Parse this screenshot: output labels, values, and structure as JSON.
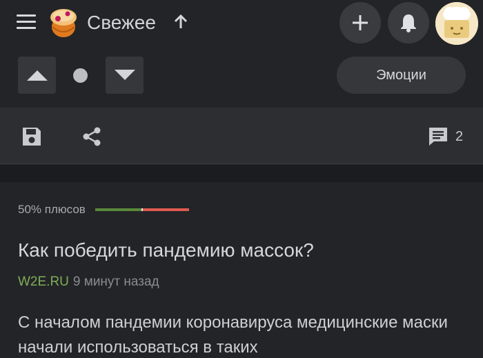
{
  "header": {
    "feed_title": "Свежее",
    "menu_icon": "hamburger-icon",
    "logo_icon": "pikabu-logo-icon",
    "sort_icon": "arrow-up-icon",
    "add_icon": "plus-icon",
    "notifications_icon": "bell-icon",
    "avatar_icon": "user-avatar"
  },
  "vote_bar": {
    "upvote_icon": "triangle-up-icon",
    "downvote_icon": "triangle-down-icon",
    "emotions_label": "Эмоции"
  },
  "actions": {
    "save_icon": "save-icon",
    "share_icon": "share-icon",
    "comments_icon": "comment-icon",
    "comments_count": "2"
  },
  "post": {
    "rating_text": "50% плюсов",
    "rating_positive_fraction": 0.5,
    "title": "Как победить пандемию массок?",
    "author": "W2E.RU",
    "time": "9 минут назад",
    "text": "С началом пандемии коронавируса медицинские маски начали использоваться в таких"
  },
  "colors": {
    "background": "#232428",
    "panel": "#2d2e32",
    "author_green": "#7fae56",
    "rating_positive": "#5a8a3a",
    "rating_negative": "#e05a50"
  }
}
